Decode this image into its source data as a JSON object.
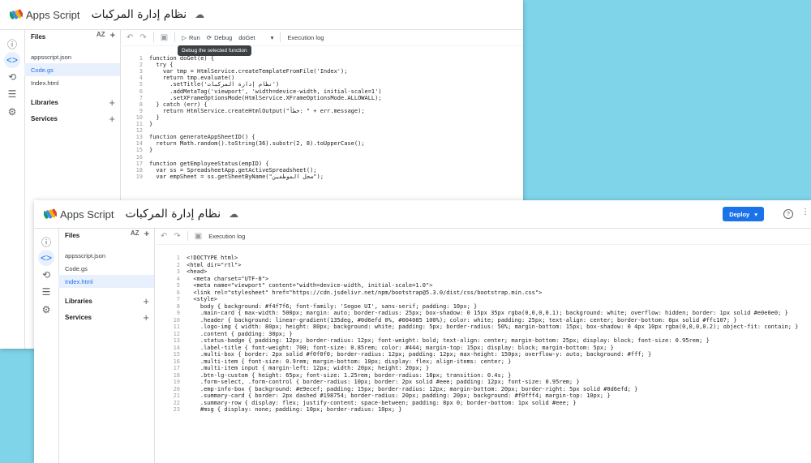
{
  "colors": {
    "accent": "#1a73e8",
    "background": "#7fd4ea"
  },
  "app_name": "Apps Script",
  "project_title": "نظام إدارة المركبات",
  "icons": {
    "cloud": "cloud-icon",
    "logo": "apps-script-logo",
    "rail": [
      "info-icon",
      "code-icon",
      "history-icon",
      "triggers-icon",
      "settings-icon"
    ]
  },
  "window1": {
    "sidebar": {
      "files_label": "Files",
      "sort_label": "AZ",
      "files": [
        "appsscript.json",
        "Code.gs",
        "Index.html"
      ],
      "libraries_label": "Libraries",
      "services_label": "Services"
    },
    "toolbar": {
      "run_label": "Run",
      "debug_label": "Debug",
      "function_name": "doGet",
      "exec_log_label": "Execution log"
    },
    "tooltip": "Debug the selected function",
    "code": [
      "function doGet(e) {",
      "  try {",
      "    var tmp = HtmlService.createTemplateFromFile('Index');",
      "    return tmp.evaluate()",
      "      .setTitle('نظام إدارة المركبات')",
      "      .addMetaTag('viewport', 'width=device-width, initial-scale=1')",
      "      .setXFrameOptionsMode(HtmlService.XFrameOptionsMode.ALLOWALL);",
      "  } catch (err) {",
      "    return HtmlService.createHtmlOutput(\"خطأ: \" + err.message);",
      "  }",
      "}",
      "",
      "function generateAppSheetID() {",
      "  return Math.random().toString(36).substr(2, 8).toUpperCase();",
      "}",
      "",
      "function getEmployeeStatus(empID) {",
      "  var ss = SpreadsheetApp.getActiveSpreadsheet();",
      "  var empSheet = ss.getSheetByName(\"سجل الموظفين\");"
    ]
  },
  "window2": {
    "deploy_label": "Deploy",
    "sidebar": {
      "files_label": "Files",
      "sort_label": "AZ",
      "files": [
        "appsscript.json",
        "Code.gs",
        "Index.html"
      ],
      "libraries_label": "Libraries",
      "services_label": "Services"
    },
    "toolbar": {
      "exec_log_label": "Execution log"
    },
    "code": [
      "<!DOCTYPE html>",
      "<html dir=\"rtl\">",
      "<head>",
      "  <meta charset=\"UTF-8\">",
      "  <meta name=\"viewport\" content=\"width=device-width, initial-scale=1.0\">",
      "  <link rel=\"stylesheet\" href=\"https://cdn.jsdelivr.net/npm/bootstrap@5.3.0/dist/css/bootstrap.min.css\">",
      "  <style>",
      "    body { background: #f4f7f6; font-family: 'Segoe UI', sans-serif; padding: 10px; }",
      "    .main-card { max-width: 500px; margin: auto; border-radius: 25px; box-shadow: 0 15px 35px rgba(0,0,0,0.1); background: white; overflow: hidden; border: 1px solid #e0e0e0; }",
      "    .header { background: linear-gradient(135deg, #0d6efd 0%, #004085 100%); color: white; padding: 25px; text-align: center; border-bottom: 6px solid #ffc107; }",
      "    .logo-img { width: 80px; height: 80px; background: white; padding: 5px; border-radius: 50%; margin-bottom: 15px; box-shadow: 0 4px 10px rgba(0,0,0,0.2); object-fit: contain; }",
      "    .content { padding: 30px; }",
      "    .status-badge { padding: 12px; border-radius: 12px; font-weight: bold; text-align: center; margin-bottom: 25px; display: block; font-size: 0.95rem; }",
      "    .label-title { font-weight: 700; font-size: 0.85rem; color: #444; margin-top: 15px; display: block; margin-bottom: 5px; }",
      "    .multi-box { border: 2px solid #f0f0f0; border-radius: 12px; padding: 12px; max-height: 150px; overflow-y: auto; background: #fff; }",
      "    .multi-item { font-size: 0.9rem; margin-bottom: 10px; display: flex; align-items: center; }",
      "    .multi-item input { margin-left: 12px; width: 20px; height: 20px; }",
      "    .btn-lg-custom { height: 65px; font-size: 1.25rem; border-radius: 18px; transition: 0.4s; }",
      "    .form-select, .form-control { border-radius: 10px; border: 2px solid #eee; padding: 12px; font-size: 0.95rem; }",
      "    .emp-info-box { background: #e9ecef; padding: 15px; border-radius: 12px; margin-bottom: 20px; border-right: 5px solid #0d6efd; }",
      "    .summary-card { border: 2px dashed #198754; border-radius: 20px; padding: 20px; background: #f0fff4; margin-top: 10px; }",
      "    .summary-row { display: flex; justify-content: space-between; padding: 8px 0; border-bottom: 1px solid #eee; }",
      "    #msg { display: none; padding: 10px; border-radius: 10px; }"
    ]
  }
}
